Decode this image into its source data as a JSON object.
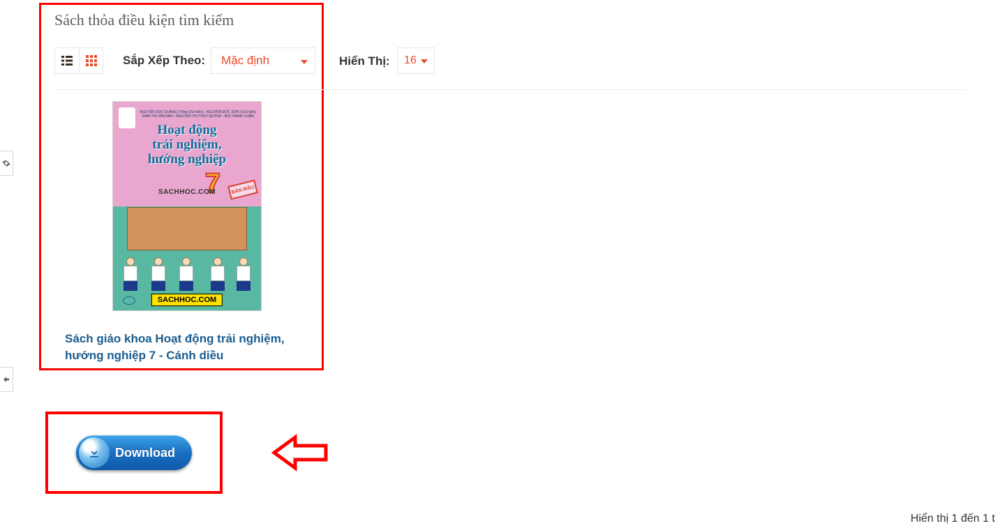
{
  "page_title": "Sách thỏa điều kiện tìm kiếm",
  "toolbar": {
    "sort_label": "Sắp Xếp Theo:",
    "sort_value": "Mặc định",
    "show_label": "Hiển Thị:",
    "show_value": "16"
  },
  "book": {
    "cover": {
      "title_line1": "Hoạt động",
      "title_line2": "trải nghiệm,",
      "title_line3": "hướng nghiệp",
      "number": "7",
      "watermark": "SACHHOC.COM",
      "stamp": "BẢN MẪU",
      "bottom_tag": "SACHHOC.COM",
      "authors": "NGUYỄN DỤC QUANG (Tổng Chủ biên) - NGUYỄN ĐỨC SƠN (Chủ biên) ĐÀM THỊ VÂN ANH - NGUYỄN THỊ THỦY QUỲNH - BÙI THANH XUÂN"
    },
    "title": "Sách giáo khoa Hoạt động trải nghiệm, hướng nghiệp 7 - Cánh diều"
  },
  "download": {
    "label": "Download"
  },
  "footer": {
    "text": "Hiển thị 1 đến 1 t"
  }
}
